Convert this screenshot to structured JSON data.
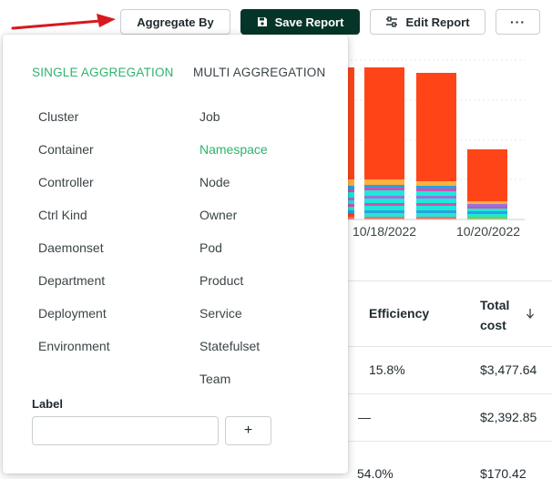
{
  "toolbar": {
    "aggregate_label": "Aggregate By",
    "save_label": "Save Report",
    "edit_label": "Edit Report",
    "more_label": "···"
  },
  "chart_data": {
    "type": "bar",
    "stacked": true,
    "tick_labels": [
      "10/18/2022",
      "10/20/2022"
    ],
    "colors": [
      "#ff4518",
      "#ffb13d",
      "#29a2e1",
      "#1ee8d8",
      "#d44fb2",
      "#9c6fdb",
      "#8bc34a",
      "#ff6f61"
    ],
    "grid": true
  },
  "table": {
    "headers": {
      "efficiency": "Efficiency",
      "total_cost": "Total cost"
    },
    "rows": [
      {
        "efficiency": "15.8%",
        "total_cost": "$3,477.64"
      },
      {
        "efficiency": "—",
        "total_cost": "$2,392.85"
      },
      {
        "efficiency": "54.0%",
        "total_cost": "$170.42"
      }
    ]
  },
  "popover": {
    "tabs": {
      "single": "SINGLE AGGREGATION",
      "multi": "MULTI AGGREGATION"
    },
    "left_options": [
      "Cluster",
      "Container",
      "Controller",
      "Ctrl Kind",
      "Daemonset",
      "Department",
      "Deployment",
      "Environment"
    ],
    "right_options": [
      "Job",
      "Namespace",
      "Node",
      "Owner",
      "Pod",
      "Product",
      "Service",
      "Statefulset",
      "Team"
    ],
    "selected": "Namespace",
    "label_title": "Label",
    "label_value": "",
    "add_label": "+"
  }
}
